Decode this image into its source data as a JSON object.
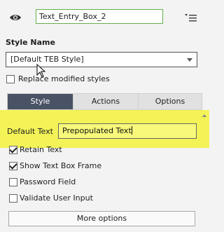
{
  "header": {
    "name_value": "Text_Entry_Box_2",
    "eye_icon": "eye-icon",
    "menu_icon": "options-menu-icon"
  },
  "style": {
    "label": "Style Name",
    "selected": "[Default TEB Style]",
    "replace_label": "Replace modified styles",
    "replace_checked": false
  },
  "tabs": [
    {
      "label": "Style",
      "active": true
    },
    {
      "label": "Actions",
      "active": false
    },
    {
      "label": "Options",
      "active": false
    }
  ],
  "default_text": {
    "label": "Default Text",
    "value": "Prepopulated Text"
  },
  "checkboxes": [
    {
      "label": "Retain Text",
      "checked": true
    },
    {
      "label": "Show Text Box Frame",
      "checked": true
    },
    {
      "label": "Password Field",
      "checked": false
    },
    {
      "label": "Validate User Input",
      "checked": false
    }
  ],
  "more_options_label": "More options",
  "colors": {
    "highlight": "#f3f357",
    "active_tab": "#4a5265",
    "name_border": "#62b04a"
  }
}
